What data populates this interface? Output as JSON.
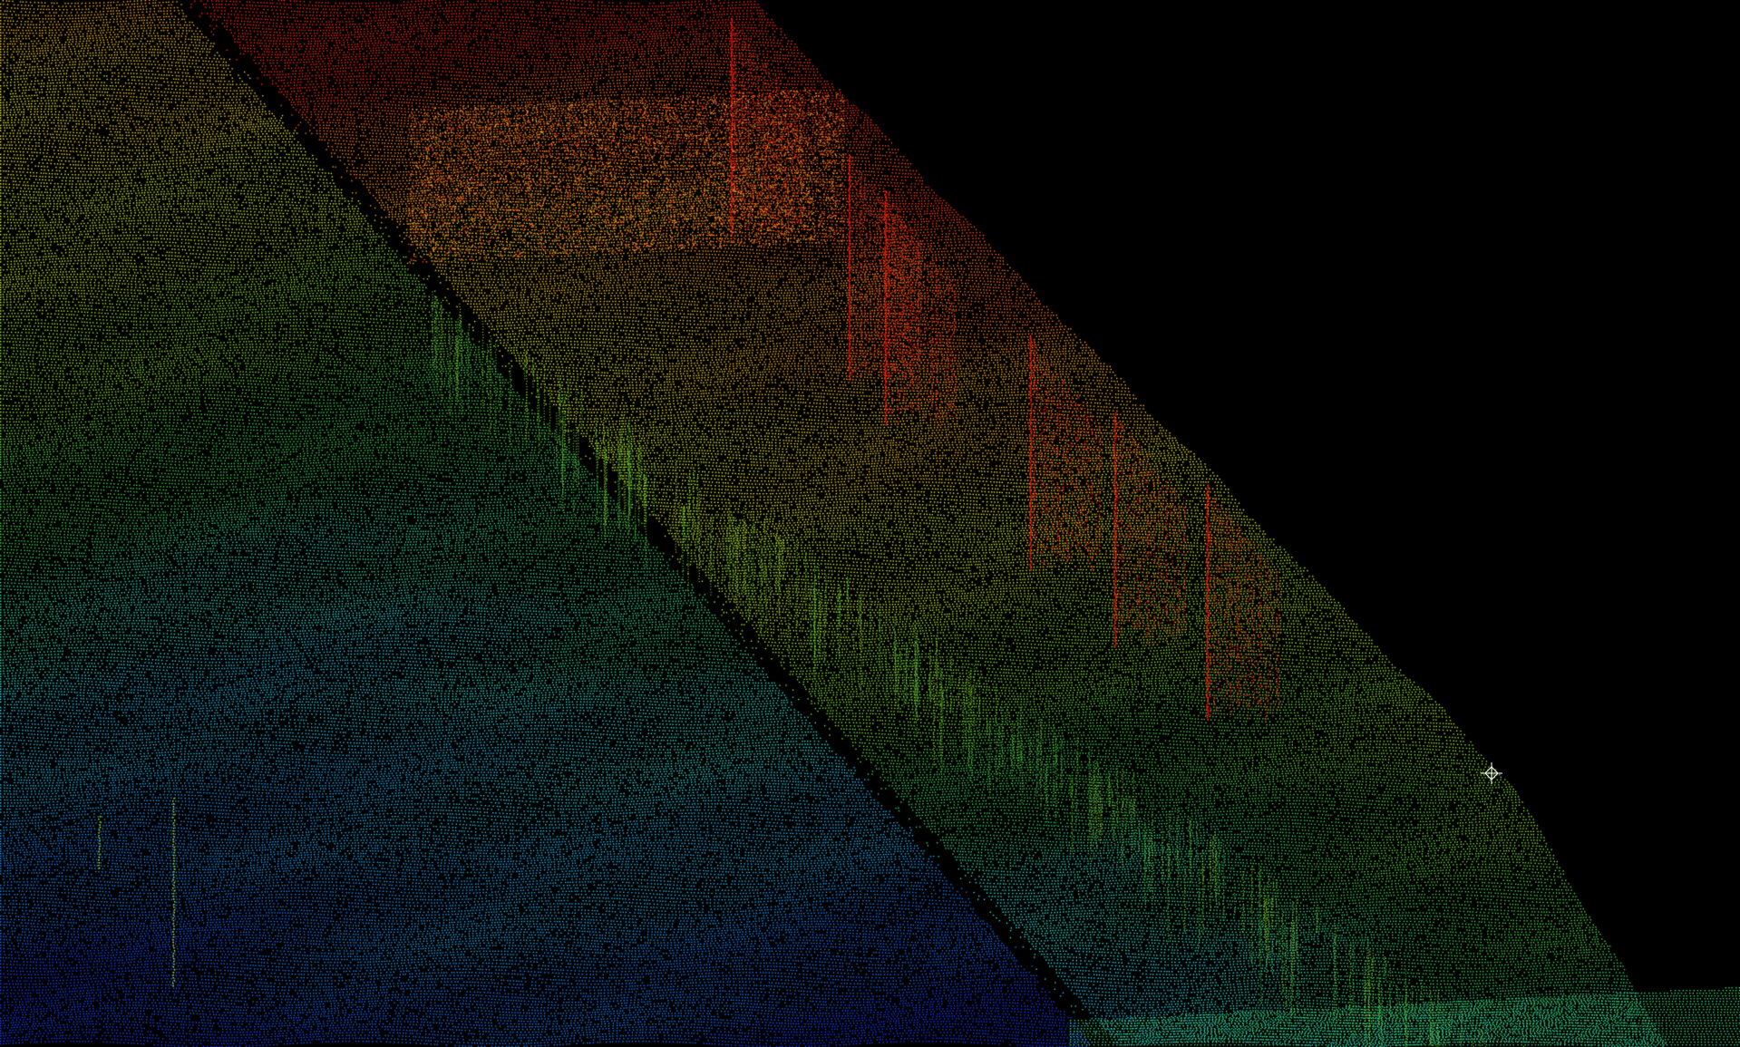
{
  "viewer": {
    "background_color": "#000000",
    "view_mode": "3d-point-cloud",
    "color_scale": "elevation",
    "colormap": [
      "#1a3cff",
      "#14a0ff",
      "#28e0e6",
      "#3cd25a",
      "#a0e628",
      "#f0f028",
      "#ffa01e",
      "#ff2814"
    ],
    "cursor_icon": "crosshair-pivot-icon",
    "pivot_color": "#ffffff"
  }
}
